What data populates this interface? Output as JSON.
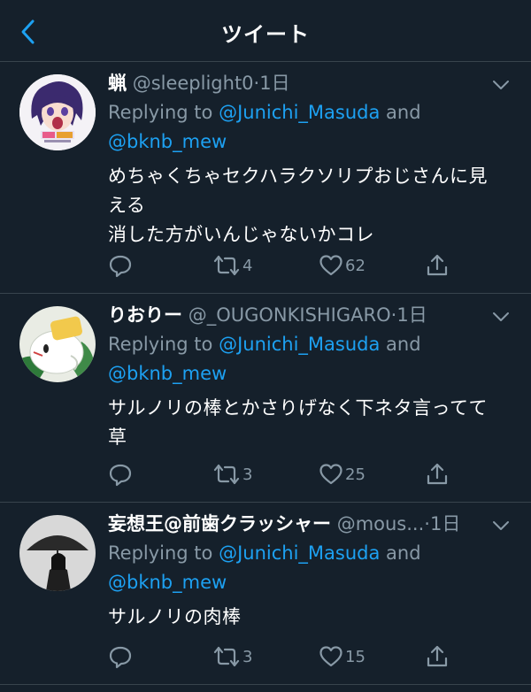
{
  "header": {
    "title": "ツイート"
  },
  "tweets": [
    {
      "author": "蝋",
      "handle": "@sleeplight0",
      "dot": "·",
      "time": "1日",
      "replying_prefix": "Replying to ",
      "mention1": "@Junichi_Masuda",
      "and": " and",
      "mention2": "@bknb_mew",
      "body_lines": [
        "めちゃくちゃセクハラクソリプおじさんに見",
        "える",
        "消した方がいんじゃないかコレ"
      ],
      "retweets": "4",
      "likes": "62"
    },
    {
      "author": "りおりー",
      "handle": "@_OUGONKISHIGARO",
      "dot": "·",
      "time": "1日",
      "replying_prefix": "Replying to ",
      "mention1": "@Junichi_Masuda",
      "and": " and",
      "mention2": "@bknb_mew",
      "body_lines": [
        "サルノリの棒とかさりげなく下ネタ言ってて",
        "草"
      ],
      "retweets": "3",
      "likes": "25"
    },
    {
      "author": "妄想王@前歯クラッシャー",
      "handle": "@mous...",
      "dot": "·",
      "time": "1日",
      "replying_prefix": "Replying to ",
      "mention1": "@Junichi_Masuda",
      "and": " and",
      "mention2": "@bknb_mew",
      "body_lines": [
        "サルノリの肉棒"
      ],
      "retweets": "3",
      "likes": "15"
    }
  ],
  "colors": {
    "background": "#15202b",
    "accent": "#1da1f2",
    "muted": "#8899a6",
    "divider": "#38444d"
  },
  "icons": [
    "back-arrow-icon",
    "chevron-down-icon",
    "reply-icon",
    "retweet-icon",
    "like-icon",
    "share-icon"
  ]
}
